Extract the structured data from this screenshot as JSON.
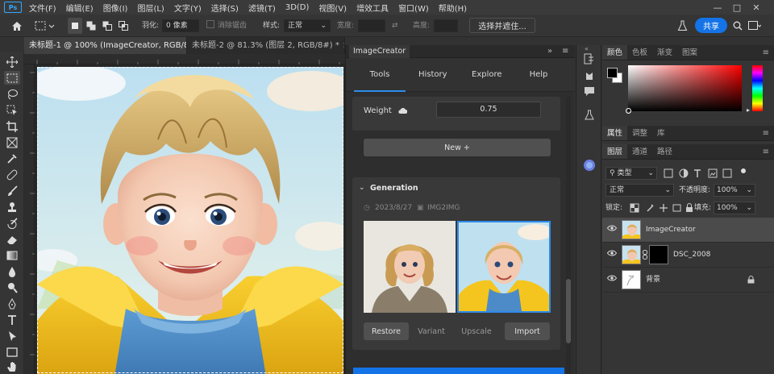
{
  "app": {
    "logo": "Ps"
  },
  "menu": [
    "文件(F)",
    "编辑(E)",
    "图像(I)",
    "图层(L)",
    "文字(Y)",
    "选择(S)",
    "滤镜(T)",
    "3D(D)",
    "视图(V)",
    "增效工具",
    "窗口(W)",
    "帮助(H)"
  ],
  "window_controls": [
    "—",
    "□",
    "✕"
  ],
  "options": {
    "feather_label": "羽化:",
    "feather_value": "0 像素",
    "antialias_label": "消除锯齿",
    "style_label": "样式:",
    "style_value": "正常",
    "width_label": "宽度:",
    "height_label": "高度:",
    "select_mask": "选择并遮住...",
    "share": "共享"
  },
  "doc_tabs": [
    {
      "title": "未标题-1 @ 100% (ImageCreator, RGB/8#) *",
      "close": "×"
    },
    {
      "title": "未标题-2 @ 81.3% (图层 2, RGB/8#) *",
      "close": "×"
    }
  ],
  "plugin": {
    "panel_title": "ImageCreator",
    "tabs": [
      "Tools",
      "History",
      "Explore",
      "Help"
    ],
    "active_tab": "Tools",
    "weight_label": "Weight",
    "weight_value": "0.75",
    "new_button": "New +",
    "generation_title": "Generation",
    "gen_date": "2023/8/27",
    "gen_mode": "IMG2IMG",
    "actions": [
      "Restore",
      "Variant",
      "Upscale",
      "Import"
    ]
  },
  "color_panel": {
    "tabs": [
      "颜色",
      "色板",
      "渐变",
      "图案"
    ],
    "active": "颜色",
    "fg_color": "#000000",
    "bg_color": "#ffffff",
    "hue_color": "#ff0000"
  },
  "props_panel": {
    "tabs": [
      "属性",
      "调整",
      "库"
    ],
    "active": "属性"
  },
  "layers_panel": {
    "tabs": [
      "图层",
      "通道",
      "路径"
    ],
    "active": "图层",
    "kind_filter": "类型",
    "blend_mode": "正常",
    "opacity_label": "不透明度:",
    "opacity_value": "100%",
    "lock_label": "锁定:",
    "fill_label": "填充:",
    "fill_value": "100%",
    "layers": [
      {
        "name": "ImageCreator",
        "selected": true
      },
      {
        "name": "DSC_2008",
        "selected": false
      },
      {
        "name": "背景",
        "selected": false
      }
    ]
  },
  "colors": {
    "accent": "#1473e6",
    "tab_underline": "#2d8ceb",
    "selection": "#2d8ceb"
  }
}
